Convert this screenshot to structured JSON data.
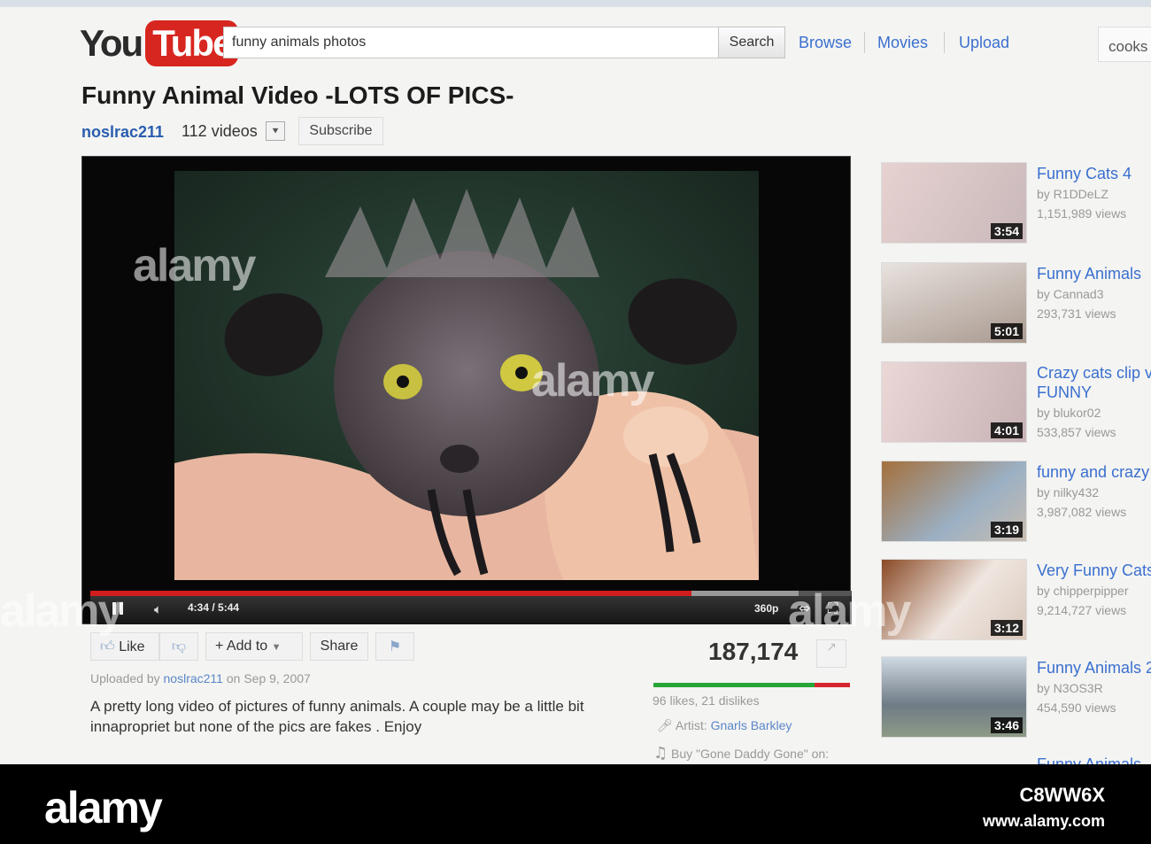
{
  "header": {
    "logo_you": "You",
    "logo_tube": "Tube",
    "search_value": "funny animals photos",
    "search_button": "Search",
    "nav": [
      "Browse",
      "Movies",
      "Upload"
    ],
    "user_text": "cooks"
  },
  "video": {
    "title": "Funny Animal Video -LOTS OF PICS-",
    "channel": "noslrac211",
    "video_count": "112 videos",
    "subscribe": "Subscribe",
    "time": "4:34 / 5:44",
    "quality": "360p",
    "progress": 0.79,
    "buffered": 0.93
  },
  "actions": {
    "like": "Like",
    "add_to": "Add to",
    "share": "Share"
  },
  "stats": {
    "views": "187,174",
    "likes_text": "96 likes, 21 dislikes",
    "like_ratio": 0.82
  },
  "details": {
    "uploaded_prefix": "Uploaded by",
    "uploader": "noslrac211",
    "uploaded_suffix": "on Sep 9, 2007",
    "description": "A pretty long video of pictures of funny animals. A couple may be a little bit innapropriet but none of the pics are fakes . Enjoy",
    "artist_label": "Artist:",
    "artist": "Gnarls Barkley",
    "buy": "Buy \"Gone Daddy Gone\" on:"
  },
  "related": [
    {
      "title": "Funny Cats 4",
      "by": "by R1DDeLZ",
      "views": "1,151,989 views",
      "duration": "3:54"
    },
    {
      "title": "Funny Animals",
      "by": "by Cannad3",
      "views": "293,731 views",
      "duration": "5:01"
    },
    {
      "title": "Crazy cats clip v FUNNY",
      "by": "by blukor02",
      "views": "533,857 views",
      "duration": "4:01"
    },
    {
      "title": "funny and crazy",
      "by": "by nilky432",
      "views": "3,987,082 views",
      "duration": "3:19"
    },
    {
      "title": "Very Funny Cats",
      "by": "by chipperpipper",
      "views": "9,214,727 views",
      "duration": "3:12"
    },
    {
      "title": "Funny Animals 2",
      "by": "by N3OS3R",
      "views": "454,590 views",
      "duration": "3:46"
    }
  ],
  "related_partial": "Funny Animals",
  "watermark": "alamy",
  "footer": {
    "logo": "alamy",
    "image_id": "C8WW6X",
    "url": "www.alamy.com"
  },
  "icons": [
    "search-icon",
    "pause-icon",
    "volume-icon",
    "thumbs-up-icon",
    "thumbs-down-icon",
    "flag-icon",
    "stats-icon",
    "mic-icon",
    "music-note-icon"
  ],
  "colors": {
    "brand_red": "#d7261f",
    "link_blue": "#3a6fd0",
    "like_green": "#26a538",
    "dislike_red": "#d6252f"
  }
}
